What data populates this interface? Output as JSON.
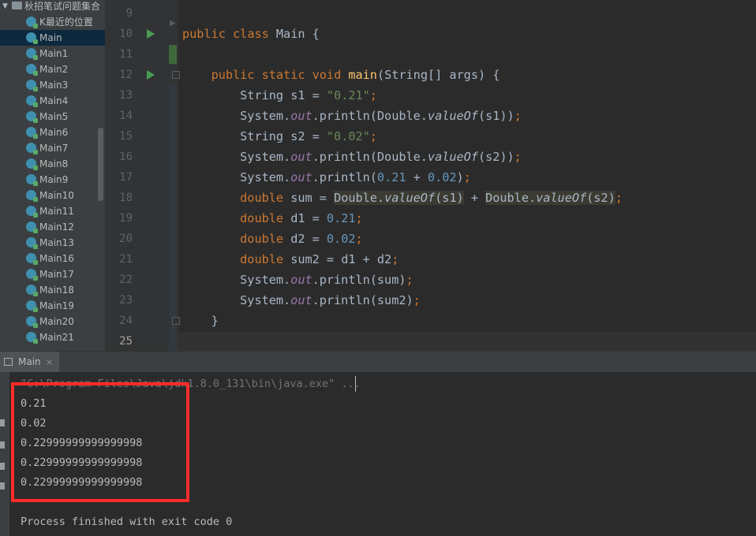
{
  "project": {
    "folder": "秋招笔试问题集合",
    "items": [
      "K最近的位置",
      "Main",
      "Main1",
      "Main2",
      "Main3",
      "Main4",
      "Main5",
      "Main6",
      "Main7",
      "Main8",
      "Main9",
      "Main10",
      "Main11",
      "Main12",
      "Main13",
      "Main16",
      "Main17",
      "Main18",
      "Main19",
      "Main20",
      "Main21"
    ],
    "selected": "Main"
  },
  "editor": {
    "line_numbers": [
      "9",
      "10",
      "11",
      "12",
      "13",
      "14",
      "15",
      "16",
      "17",
      "18",
      "19",
      "20",
      "21",
      "22",
      "23",
      "24",
      "25"
    ],
    "current_line": "25",
    "code": {
      "l10": {
        "kw1": "public",
        "kw2": "class",
        "name": "Main",
        "brace": "{"
      },
      "l12": {
        "kw1": "public",
        "kw2": "static",
        "kw3": "void",
        "method": "main",
        "params": "(String[] args) {"
      },
      "l13": {
        "type": "String",
        "rest": "s1 = ",
        "str": "\"0.21\"",
        "semi": ";"
      },
      "l14": {
        "cls": "System.",
        "field": "out",
        "call": ".println(Double.",
        "method": "valueOf",
        "args": "(s1))",
        "semi": ";"
      },
      "l15": {
        "type": "String",
        "rest": "s2 = ",
        "str": "\"0.02\"",
        "semi": ";"
      },
      "l16": {
        "cls": "System.",
        "field": "out",
        "call": ".println(Double.",
        "method": "valueOf",
        "args": "(s2))",
        "semi": ";"
      },
      "l17": {
        "cls": "System.",
        "field": "out",
        "call": ".println(",
        "n1": "0.21",
        "plus": " + ",
        "n2": "0.02",
        "close": ")",
        "semi": ";"
      },
      "l18": {
        "kw": "double",
        "rest": "sum = ",
        "h1a": "Double.",
        "h1b": "valueOf",
        "h1c": "(s1)",
        "plus": " + ",
        "h2a": "Double.",
        "h2b": "valueOf",
        "h2c": "(s2)",
        "semi": ";"
      },
      "l19": {
        "kw": "double",
        "rest": "d1 = ",
        "num": "0.21",
        "semi": ";"
      },
      "l20": {
        "kw": "double",
        "rest": "d2 = ",
        "num": "0.02",
        "semi": ";"
      },
      "l21": {
        "kw": "double",
        "rest": "sum2 = d1 + d2",
        "semi": ";"
      },
      "l22": {
        "cls": "System.",
        "field": "out",
        "call": ".println(sum)",
        "semi": ";"
      },
      "l23": {
        "cls": "System.",
        "field": "out",
        "call": ".println(sum2)",
        "semi": ";"
      },
      "l24": {
        "brace": "}"
      }
    }
  },
  "run": {
    "tab_label": "Main",
    "tab_close": "×",
    "command": "\"C:\\Program Files\\Java\\jdk1.8.0_131\\bin\\java.exe\" ...",
    "output": [
      "0.21",
      "0.02",
      "0.22999999999999998",
      "0.22999999999999998",
      "0.22999999999999998"
    ],
    "exit_message": "Process finished with exit code 0"
  },
  "colors": {
    "highlight_box": "#ff2b2b",
    "keyword": "#cc7832",
    "string": "#6a8759",
    "number": "#6897bb",
    "field": "#9876aa",
    "method": "#ffc66d"
  }
}
